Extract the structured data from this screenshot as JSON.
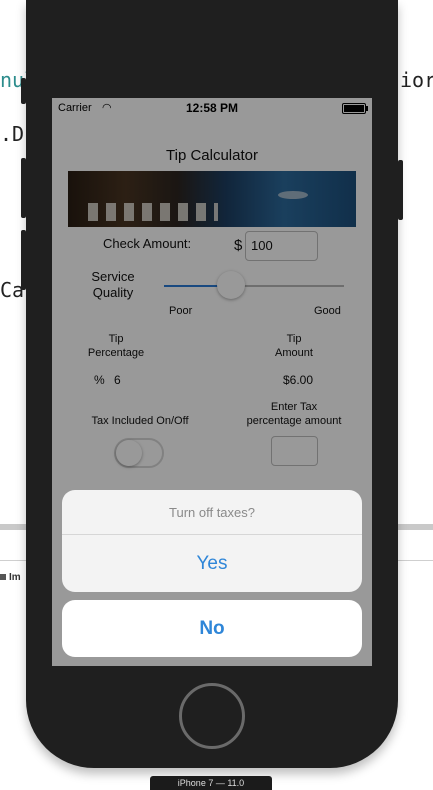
{
  "editor": {
    "frag_top_left": "nul",
    "frag_top_right": "ior",
    "frag_mid_left": ".D",
    "frag_lower_left": "Car",
    "badge": "Im"
  },
  "device": {
    "label": "iPhone 7 — 11.0"
  },
  "status": {
    "carrier": "Carrier",
    "time": "12:58 PM"
  },
  "app": {
    "title": "Tip Calculator",
    "check_amount_label": "Check Amount:",
    "currency_symbol": "$",
    "check_amount_value": "100",
    "service_quality_label": "Service\nQuality",
    "slider_min_label": "Poor",
    "slider_max_label": "Good",
    "slider_value_fraction": 0.37,
    "tip_percentage_label": "Tip\nPercentage",
    "tip_amount_label": "Tip\nAmount",
    "percent_symbol": "%",
    "tip_percentage_value": "6",
    "tip_amount_value": "$6.00",
    "tax_toggle_label": "Tax Included On/Off",
    "tax_percentage_label": "Enter Tax\npercentage amount",
    "tax_percentage_value": "",
    "tax_toggle_on": false
  },
  "alert": {
    "title": "Turn off taxes?",
    "yes_label": "Yes",
    "no_label": "No",
    "action_color": "#2f86d8"
  }
}
